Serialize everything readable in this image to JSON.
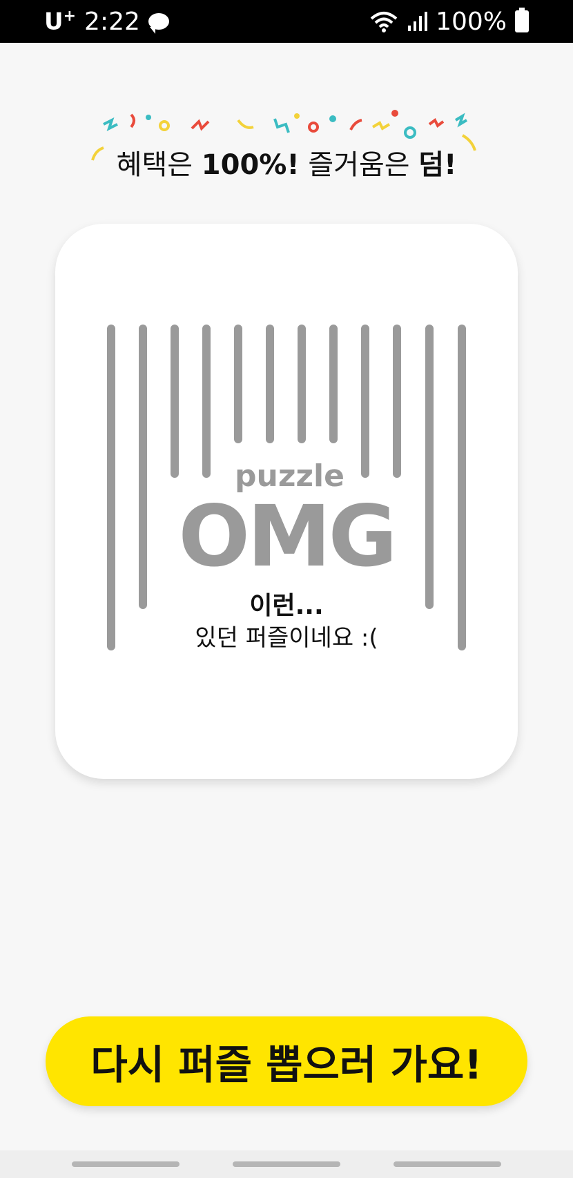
{
  "status_bar": {
    "carrier": "U",
    "carrier_sup": "+",
    "time": "2:22",
    "battery_percent": "100%"
  },
  "headline": {
    "part1": "혜택은 ",
    "part2": "100%!",
    "part3": " 즐거움은 ",
    "part4": "덤!"
  },
  "card": {
    "brand_small": "puzzle",
    "brand_big": "OMG",
    "result_title": "이런...",
    "result_subtitle": "있던 퍼즐이네요 :("
  },
  "cta": {
    "label": "다시 퍼즐 뽑으러 가요!"
  },
  "colors": {
    "accent_yellow": "#ffe500",
    "bar_gray": "#9a9a9a"
  }
}
